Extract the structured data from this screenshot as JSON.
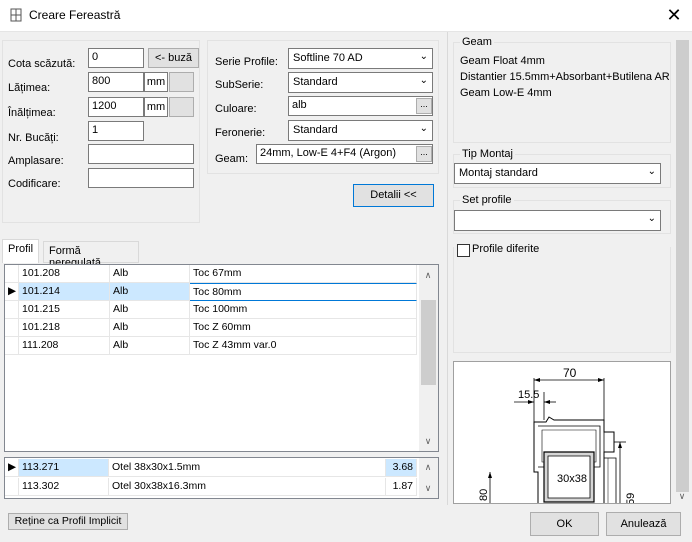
{
  "window": {
    "title": "Creare Fereastră"
  },
  "left": {
    "cota_label": "Cota scăzută:",
    "cota_value": "0",
    "buza_button": "<- buză",
    "latime_label": "Lățimea:",
    "latime_value": "800",
    "latime_unit": "mm",
    "inaltime_label": "Înălțimea:",
    "inaltime_value": "1200",
    "inaltime_unit": "mm",
    "bucati_label": "Nr. Bucăți:",
    "bucati_value": "1",
    "amplasare_label": "Amplasare:",
    "amplasare_value": "",
    "codificare_label": "Codificare:",
    "codificare_value": ""
  },
  "mid": {
    "serie_label": "Serie Profile:",
    "serie_value": "Softline 70 AD",
    "subserie_label": "SubSerie:",
    "subserie_value": "Standard",
    "culoare_label": "Culoare:",
    "culoare_value": "alb",
    "feronerie_label": "Feronerie:",
    "feronerie_value": "Standard",
    "geam_label": "Geam:",
    "geam_value": "24mm, Low-E 4+F4 (Argon)",
    "ellipsis": "...",
    "detalii_button": "Detalii <<"
  },
  "tabs": [
    {
      "label": "Profil"
    },
    {
      "label": "Formă neregulată"
    }
  ],
  "profiles": [
    {
      "code": "101.208",
      "color": "Alb",
      "desc": "Toc 67mm",
      "selected": false
    },
    {
      "code": "101.214",
      "color": "Alb",
      "desc": "Toc 80mm",
      "selected": true
    },
    {
      "code": "101.215",
      "color": "Alb",
      "desc": "Toc 100mm",
      "selected": false
    },
    {
      "code": "101.218",
      "color": "Alb",
      "desc": "Toc Z 60mm",
      "selected": false
    },
    {
      "code": "111.208",
      "color": "Alb",
      "desc": "Toc Z 43mm var.0",
      "selected": false
    }
  ],
  "reinforcements": [
    {
      "code": "113.271",
      "desc": "Otel 38x30x1.5mm",
      "value": "3.68",
      "selected": true
    },
    {
      "code": "113.302",
      "desc": "Otel 30x38x16.3mm",
      "value": "1.87",
      "selected": false
    }
  ],
  "right": {
    "geam_group": "Geam",
    "geam_lines": [
      "Geam Float 4mm",
      "Distantier 15.5mm+Absorbant+Butilena AR",
      "Geam Low-E 4mm"
    ],
    "montaj_group": "Tip Montaj",
    "montaj_value": "Montaj standard",
    "set_group": "Set profile",
    "set_value": "",
    "profile_diferite": "Profile diferite"
  },
  "drawing": {
    "dim_top": "70",
    "dim_sub": "15.5",
    "dim_left": "80",
    "dim_right": "59",
    "box_label": "30x38"
  },
  "footer": {
    "default_button": "Reține ca Profil Implicit",
    "ok_button": "OK",
    "cancel_button": "Anulează"
  },
  "colors": {
    "selection": "#cce8ff",
    "accent_border": "#0078d7"
  }
}
